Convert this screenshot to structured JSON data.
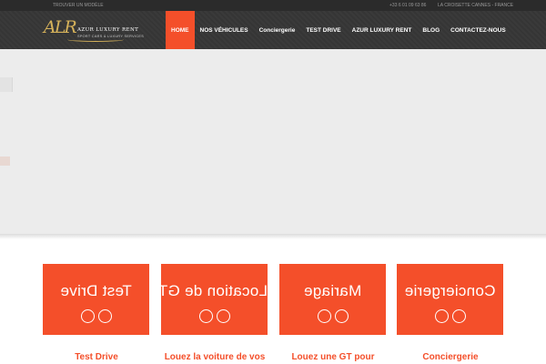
{
  "topbar": {
    "left_link": "TROUVER UN MODÈLE",
    "phone": "+33 6 01 09 63 86",
    "location": "LA CROISETTE CANNES - FRANCE"
  },
  "logo": {
    "monogram": "ALR",
    "brand": "AZUR LUXURY RENT",
    "tagline": "SPORT CARS & LUXURY SERVICES"
  },
  "nav": {
    "items": [
      {
        "label": "HOME",
        "active": true
      },
      {
        "label": "NOS VÉHICULES"
      },
      {
        "label": "Conciergerie"
      },
      {
        "label": "TEST DRIVE"
      },
      {
        "label": "AZUR LUXURY RENT"
      },
      {
        "label": "BLOG"
      },
      {
        "label": "CONTACTEZ-NOUS"
      }
    ]
  },
  "services": [
    {
      "box_title": "Test Drive",
      "caption": "Test Drive"
    },
    {
      "box_title": "Location de GT",
      "caption": "Louez la voiture de vos"
    },
    {
      "box_title": "Mariage",
      "caption": "Louez une GT pour"
    },
    {
      "box_title": "Conciergerie",
      "caption": "Conciergerie"
    }
  ],
  "colors": {
    "accent": "#f44f2a",
    "topbar": "#2b2b2b",
    "header": "#3a3a3a",
    "hero": "#ececec",
    "logo_gold": "#d6b25a"
  },
  "icons": {
    "service_icon": "double-circle-icon",
    "slider_prev": "slider-prev-handle",
    "slider_next": "slider-next-handle"
  }
}
